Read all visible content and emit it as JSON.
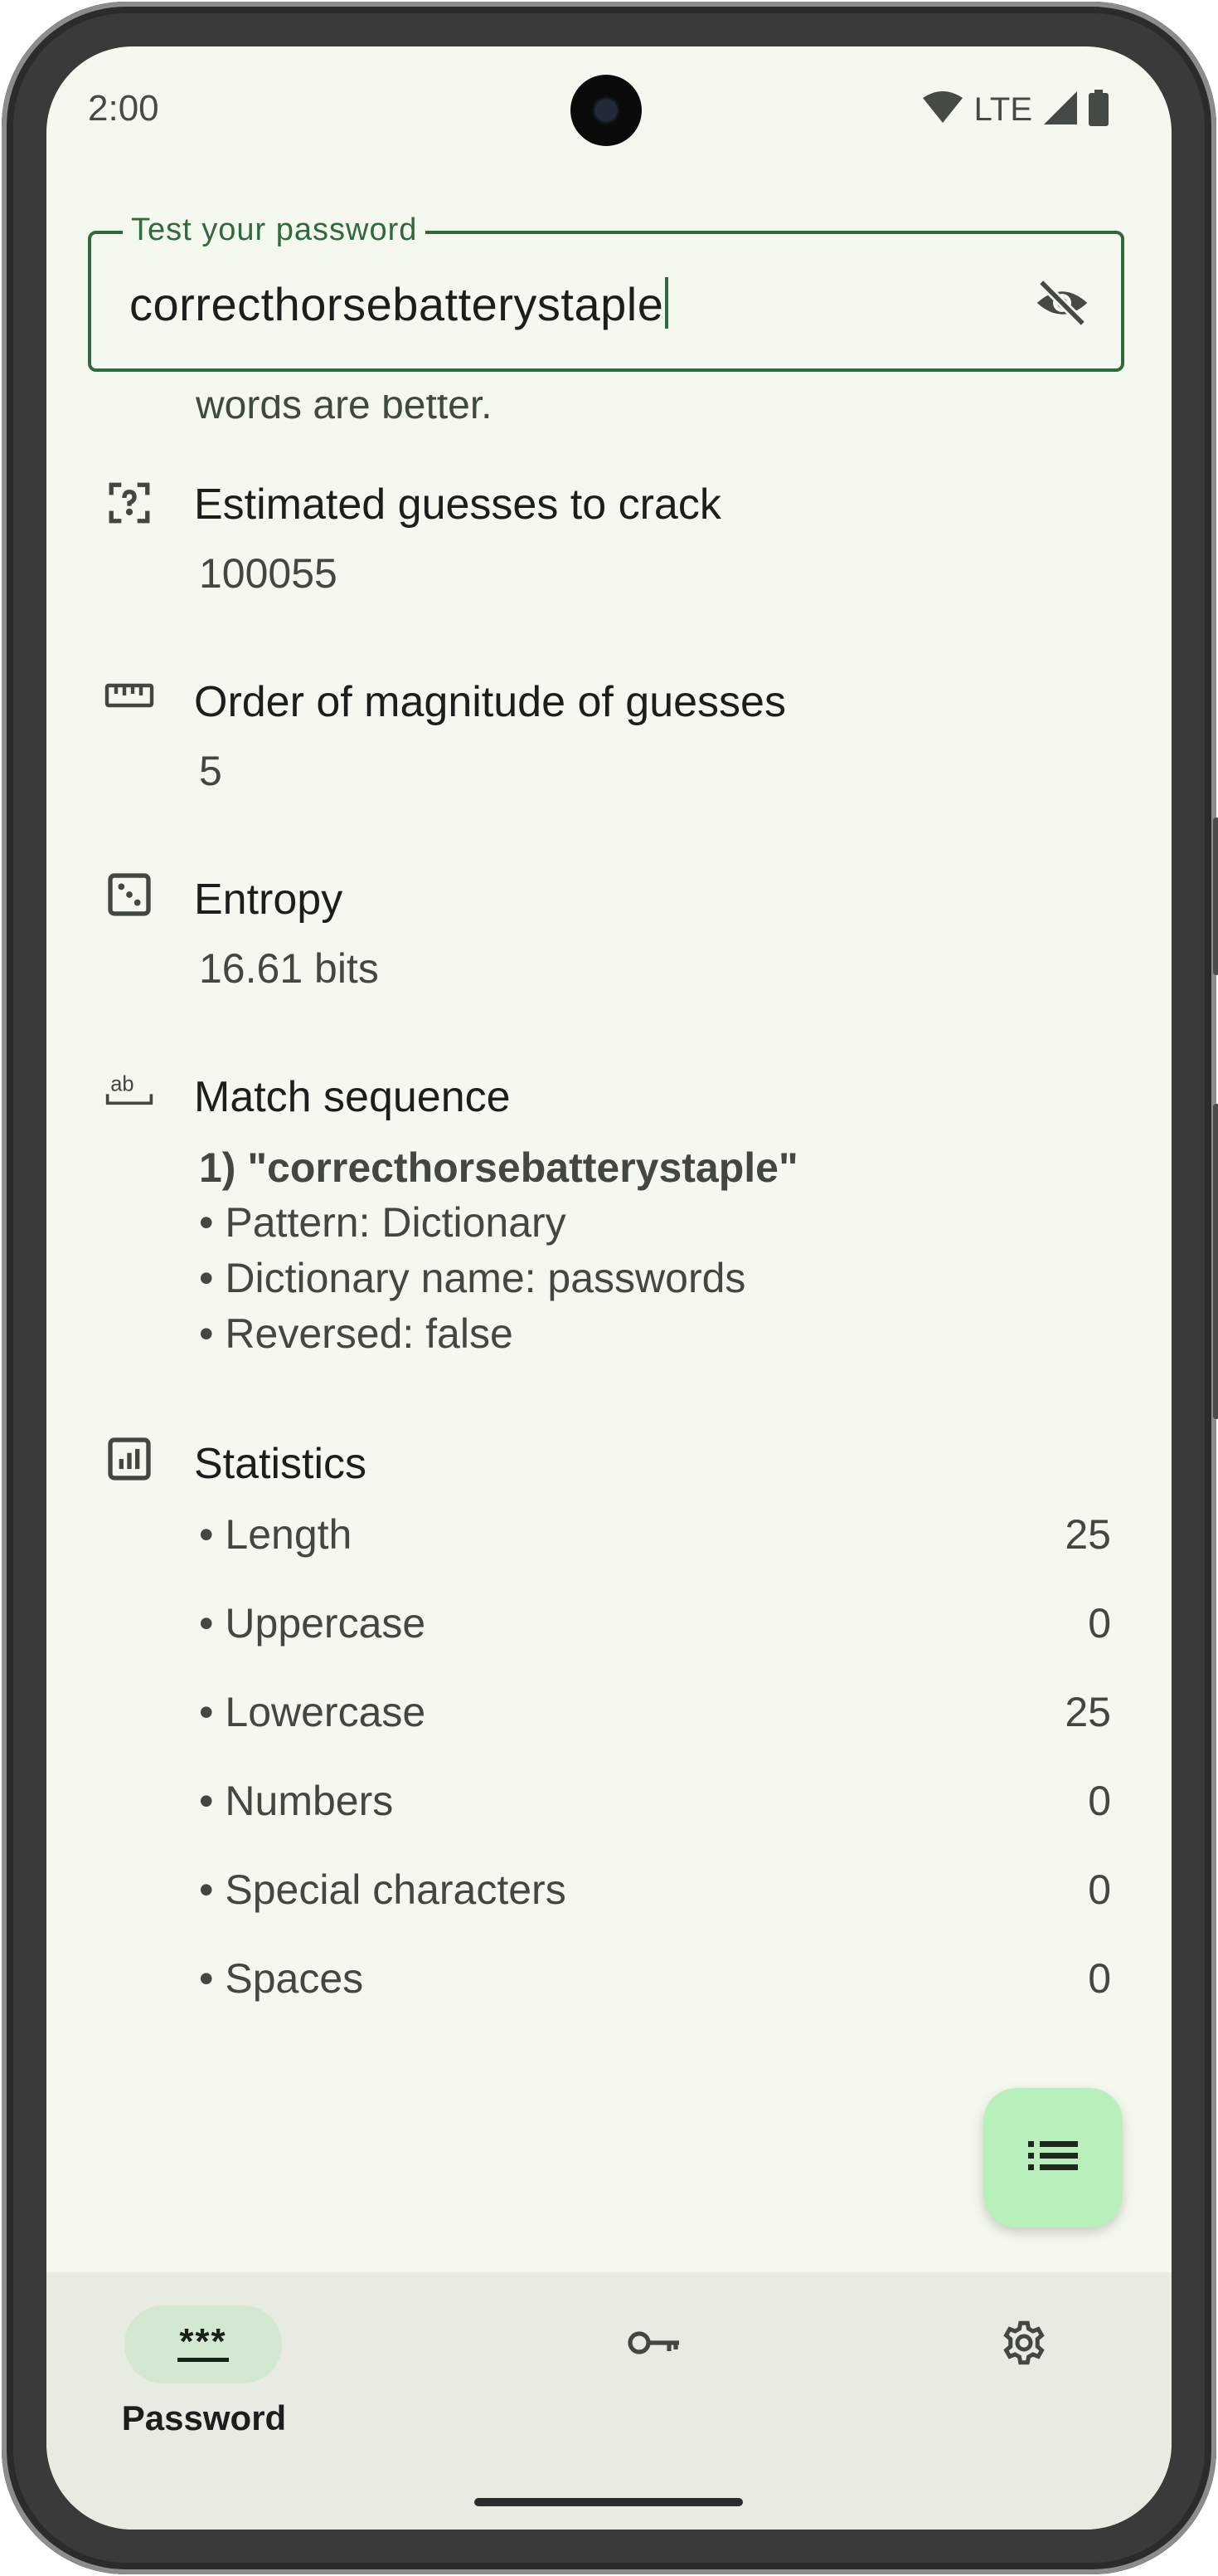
{
  "status_bar": {
    "time": "2:00",
    "network": "LTE"
  },
  "password_field": {
    "label": "Test your password",
    "value": "correcthorsebatterystaple",
    "partially_hidden_text": "words are better."
  },
  "results": {
    "guesses": {
      "title": "Estimated guesses to crack",
      "value": "100055"
    },
    "magnitude": {
      "title": "Order of magnitude of guesses",
      "value": "5"
    },
    "entropy": {
      "title": "Entropy",
      "value": "16.61 bits"
    },
    "match": {
      "title": "Match sequence",
      "items": [
        "1) \"correcthorsebatterystaple\"",
        "• Pattern: Dictionary",
        "• Dictionary name: passwords",
        "• Reversed: false"
      ]
    },
    "statistics": {
      "title": "Statistics",
      "rows": [
        {
          "label": "• Length",
          "value": "25"
        },
        {
          "label": "• Uppercase",
          "value": "0"
        },
        {
          "label": "• Lowercase",
          "value": "25"
        },
        {
          "label": "• Numbers",
          "value": "0"
        },
        {
          "label": "• Special characters",
          "value": "0"
        },
        {
          "label": "• Spaces",
          "value": "0"
        }
      ]
    }
  },
  "nav": {
    "password_label": "Password",
    "password_icon": "***"
  },
  "colors": {
    "background": "#f4f8ee",
    "accent": "#2f6a3c",
    "fab": "#b8f0bc",
    "nav_bar": "#e8ebe2",
    "nav_active_pill": "#d2e8d0"
  }
}
